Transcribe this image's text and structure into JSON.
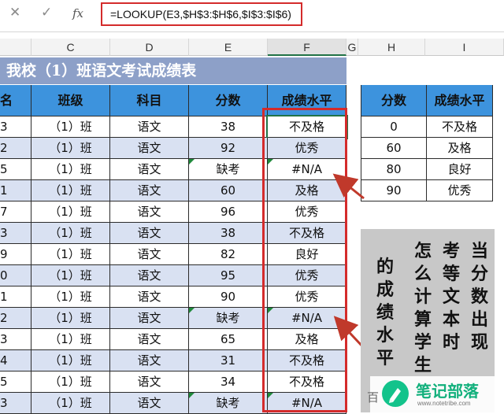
{
  "formula_bar": {
    "cancel": "✕",
    "confirm": "✓",
    "fx": "fx",
    "formula": "=LOOKUP(E3,$H$3:$H$6,$I$3:$I$6)"
  },
  "columns": [
    "C",
    "D",
    "E",
    "F",
    "G",
    "H",
    "I"
  ],
  "title": "我校（1）班语文考试成绩表",
  "table": {
    "headers": [
      "名",
      "班级",
      "科目",
      "分数",
      "成绩水平"
    ],
    "rows": [
      [
        "3",
        "（1）班",
        "语文",
        "38",
        "不及格"
      ],
      [
        "2",
        "（1）班",
        "语文",
        "92",
        "优秀"
      ],
      [
        "5",
        "（1）班",
        "语文",
        "缺考",
        "#N/A"
      ],
      [
        "1",
        "（1）班",
        "语文",
        "60",
        "及格"
      ],
      [
        "7",
        "（1）班",
        "语文",
        "96",
        "优秀"
      ],
      [
        "3",
        "（1）班",
        "语文",
        "38",
        "不及格"
      ],
      [
        "9",
        "（1）班",
        "语文",
        "82",
        "良好"
      ],
      [
        "0",
        "（1）班",
        "语文",
        "95",
        "优秀"
      ],
      [
        "1",
        "（1）班",
        "语文",
        "90",
        "优秀"
      ],
      [
        "2",
        "（1）班",
        "语文",
        "缺考",
        "#N/A"
      ],
      [
        "3",
        "（1）班",
        "语文",
        "65",
        "及格"
      ],
      [
        "4",
        "（1）班",
        "语文",
        "31",
        "不及格"
      ],
      [
        "5",
        "（1）班",
        "语文",
        "34",
        "不及格"
      ],
      [
        "3",
        "（1）班",
        "语文",
        "缺考",
        "#N/A"
      ]
    ]
  },
  "lookup_table": {
    "headers": [
      "分数",
      "成绩水平"
    ],
    "rows": [
      [
        "0",
        "不及格"
      ],
      [
        "60",
        "及格"
      ],
      [
        "80",
        "良好"
      ],
      [
        "90",
        "优秀"
      ]
    ]
  },
  "callout": {
    "columns": [
      "当分数出现",
      "考等文本时",
      "怎么计算学生",
      "的成绩水平"
    ]
  },
  "watermark": {
    "prefix": "百",
    "name": "笔记部落",
    "url": "www.notetribe.com"
  },
  "colors": {
    "accent_red": "#d42b2b",
    "header_blue": "#3d93dd",
    "band_blue": "#d9e1f2",
    "title_blue": "#8da0c8"
  }
}
